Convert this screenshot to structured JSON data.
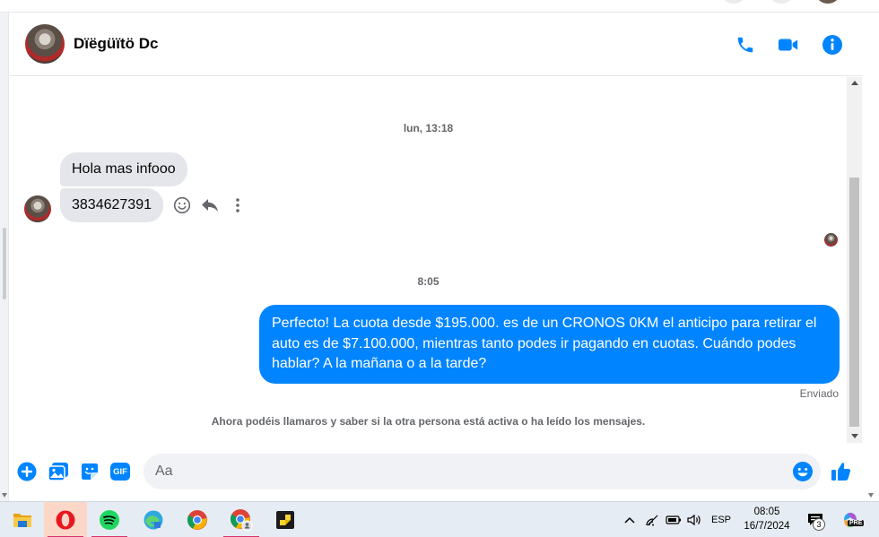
{
  "chat": {
    "contact_name": "Dïëgüïtö Dc",
    "header_actions": [
      "phone-icon",
      "video-call-icon",
      "info-icon"
    ],
    "accent_color": "#0084ff"
  },
  "messages": {
    "timestamp_1": "lun, 13:18",
    "incoming": [
      "Hola mas infooo",
      "3834627391"
    ],
    "message_actions": [
      "react-icon",
      "reply-icon",
      "more-options-icon"
    ],
    "timestamp_2": "8:05",
    "outgoing": "Perfecto! La cuota desde $195.000. es de un CRONOS 0KM el anticipo para retirar el auto es de $7.100.000, mientras tanto podes ir pagando en cuotas. Cuándo podes hablar? A la mañana o a la tarde?",
    "status": "Enviado",
    "info": "Ahora podéis llamaros y saber si la otra persona está activa o ha leído los mensajes."
  },
  "composer": {
    "placeholder": "Aa",
    "gif_label": "GIF",
    "actions": [
      "add-icon",
      "photo-icon",
      "sticker-icon",
      "gif-icon",
      "emoji-icon",
      "like-icon"
    ]
  },
  "taskbar": {
    "apps": [
      "file-explorer-icon",
      "opera-icon",
      "spotify-icon",
      "edge-icon",
      "chrome-icon",
      "chrome-profile-icon",
      "sticky-notes-icon"
    ],
    "language": "ESP",
    "time": "08:05",
    "date": "16/7/2024",
    "notification_count": "3",
    "copilot_badge": "PRE"
  }
}
